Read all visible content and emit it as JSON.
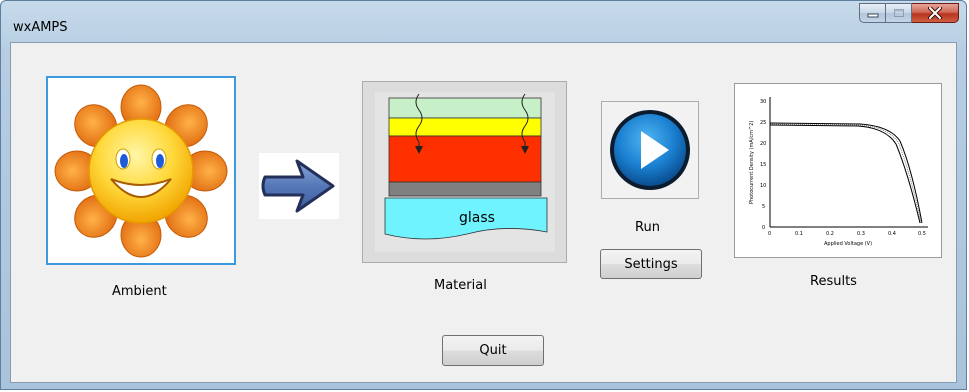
{
  "window": {
    "title": "wxAMPS",
    "minimize_icon": "minimize-icon",
    "maximize_icon": "maximize-icon",
    "close_icon": "close-icon"
  },
  "main": {
    "ambient": {
      "label": "Ambient",
      "icon": "smiling-sun-icon"
    },
    "arrow": {
      "icon": "right-arrow-icon"
    },
    "material": {
      "label": "Material",
      "icon": "layer-stack-icon",
      "substrate_label": "glass"
    },
    "run": {
      "label": "Run",
      "icon": "play-icon"
    },
    "settings_label": "Settings",
    "results": {
      "label": "Results",
      "icon": "iv-curve-plot-icon",
      "ylabel": "Photocurrent Density (mA/cm^2)",
      "xlabel": "Applied Voltage (V)",
      "y_ticks": [
        "0",
        "5",
        "10",
        "15",
        "20",
        "25",
        "30"
      ],
      "x_ticks": [
        "0",
        "0.1",
        "0.2",
        "0.3",
        "0.4",
        "0.5"
      ]
    },
    "quit_label": "Quit"
  },
  "colors": {
    "frame": "#b6cde2",
    "client_bg": "#f0f0f0",
    "focus_border": "#3c9ae0",
    "close_button": "#c4452c"
  }
}
